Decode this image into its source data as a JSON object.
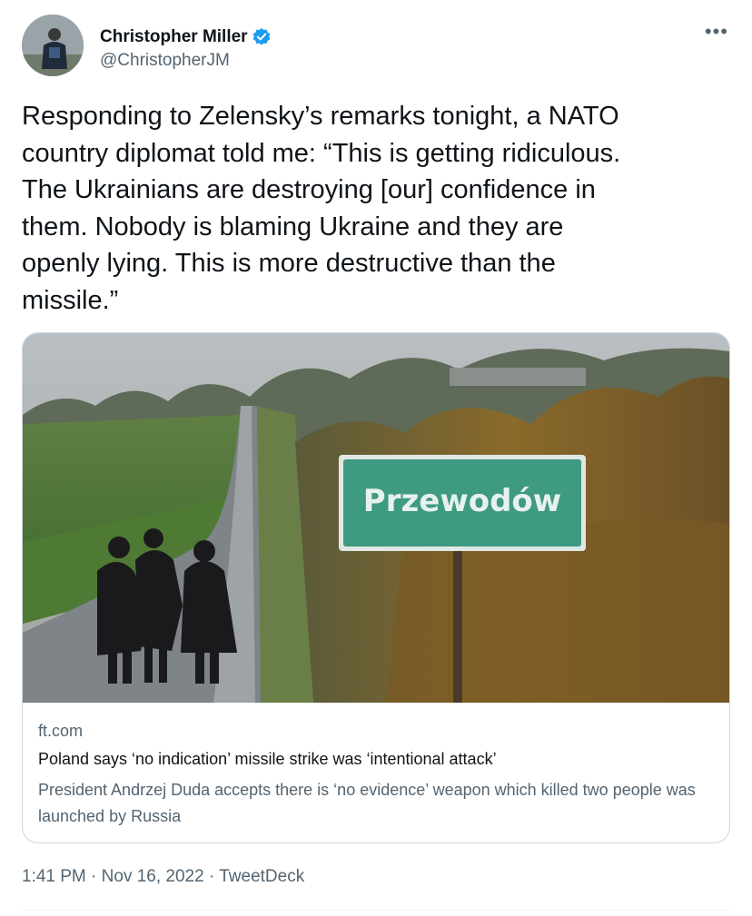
{
  "author": {
    "display_name": "Christopher Miller",
    "handle": "@ChristopherJM",
    "verified": true
  },
  "tweet": {
    "text": "Responding to Zelensky’s remarks tonight, a NATO\ncountry diplomat told me: “This is getting ridiculous.\nThe Ukrainians are destroying [our] confidence in\nthem. Nobody is blaming Ukraine and they are\nopenly lying. This is more destructive than the\nmissile.”"
  },
  "card": {
    "image_sign_text": "Przewodów",
    "domain": "ft.com",
    "title": "Poland says ‘no indication’ missile strike was ‘intentional attack’",
    "description": "President Andrzej Duda accepts there is ‘no evidence’ weapon which killed two people was launched by Russia"
  },
  "meta": {
    "time": "1:41 PM",
    "separator": "·",
    "date": "Nov 16, 2022",
    "source": "TweetDeck"
  },
  "colors": {
    "text_primary": "#0f1419",
    "text_secondary": "#536471",
    "verified_blue": "#1d9bf0",
    "sign_green": "#3f9a82",
    "border": "#cfd9de"
  },
  "icons": {
    "more": "more-horizontal-icon",
    "verified": "verified-badge-icon"
  }
}
